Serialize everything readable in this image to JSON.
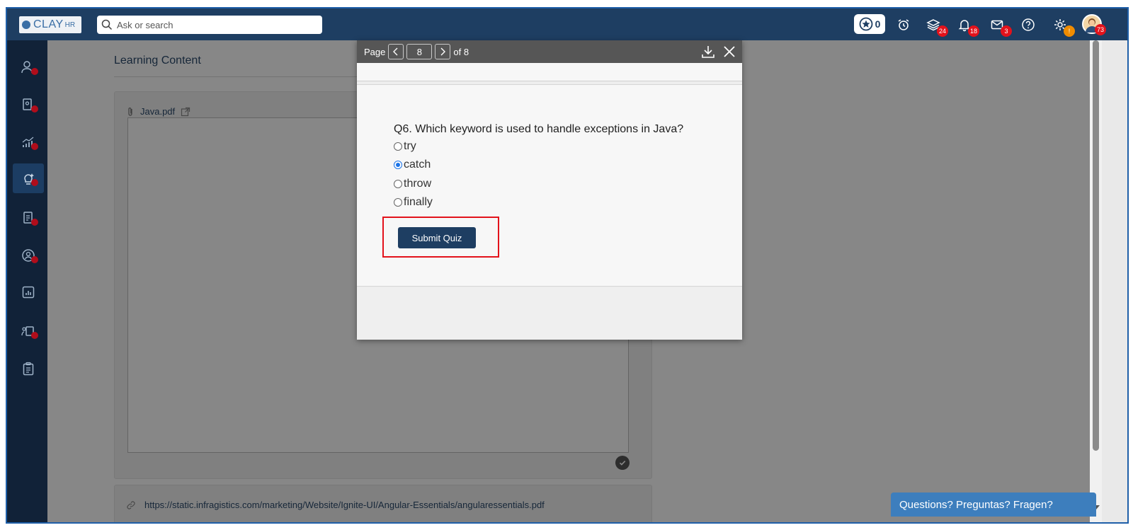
{
  "topbar": {
    "logo_word": "CLAY",
    "logo_sub": "HR",
    "search_placeholder": "Ask or search",
    "star_count": "0",
    "badges": {
      "layers": "24",
      "notifications": "18",
      "mail": "3",
      "settings": "!",
      "avatar": "73"
    }
  },
  "sidebar": {
    "items": [
      {
        "icon": "people-icon",
        "active": false
      },
      {
        "icon": "document-user-icon",
        "active": false
      },
      {
        "icon": "growth-chart-icon",
        "active": false
      },
      {
        "icon": "learning-bulb-icon",
        "active": true
      },
      {
        "icon": "documents-icon",
        "active": false
      },
      {
        "icon": "profile-circle-icon",
        "active": false
      },
      {
        "icon": "report-chart-icon",
        "active": false
      },
      {
        "icon": "training-icon",
        "active": false
      },
      {
        "icon": "clipboard-icon",
        "active": false
      }
    ]
  },
  "main": {
    "page_title": "Learning Content",
    "file_name": "Java.pdf",
    "link_url": "https://static.infragistics.com/marketing/Website/Ignite-UI/Angular-Essentials/angularessentials.pdf"
  },
  "viewer": {
    "page_label": "Page",
    "current_page": "8",
    "of_label": "of 8",
    "question": "Q6. Which keyword is used to handle exceptions in Java?",
    "options": [
      {
        "label": "try",
        "checked": false
      },
      {
        "label": "catch",
        "checked": true
      },
      {
        "label": "throw",
        "checked": false
      },
      {
        "label": "finally",
        "checked": false
      }
    ],
    "submit_label": "Submit Quiz"
  },
  "chat": {
    "label": "Questions? Preguntas? Fragen?"
  },
  "colors": {
    "topbar": "#1e3e62",
    "sidebar": "#112238",
    "badge": "#e3121b",
    "highlight": "#e3121b",
    "accent": "#3d7ebd"
  }
}
